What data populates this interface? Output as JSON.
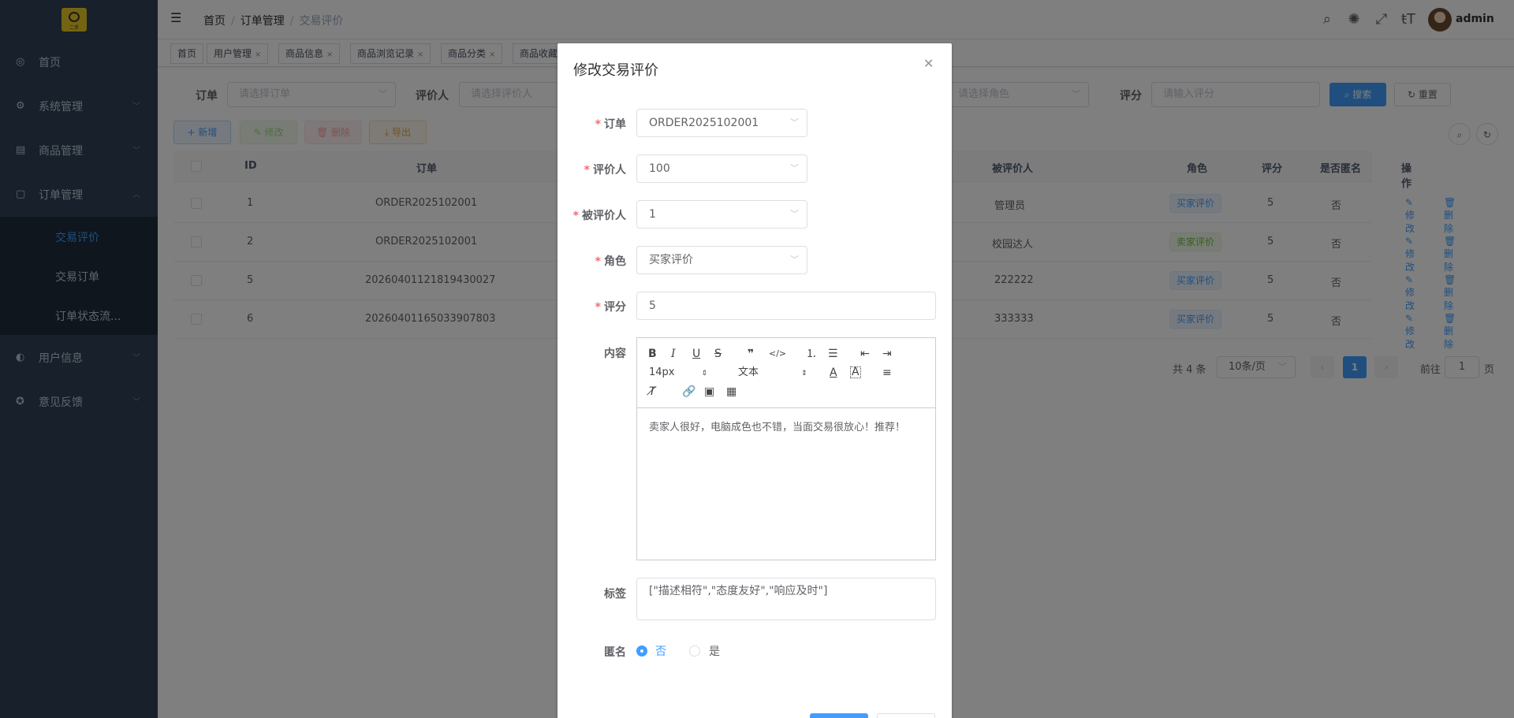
{
  "sidebar": {
    "logo_text": "二手",
    "items": [
      {
        "label": "首页",
        "icon": "dashboard-icon"
      },
      {
        "label": "系统管理",
        "icon": "gear-icon"
      },
      {
        "label": "商品管理",
        "icon": "goods-icon"
      },
      {
        "label": "订单管理",
        "icon": "book-icon"
      },
      {
        "label": "用户信息",
        "icon": "user-icon"
      },
      {
        "label": "意见反馈",
        "icon": "feedback-icon"
      }
    ],
    "sub_items": [
      {
        "label": "交易评价",
        "active": true
      },
      {
        "label": "交易订单"
      },
      {
        "label": "订单状态流..."
      }
    ]
  },
  "navbar": {
    "breadcrumb": [
      "首页",
      "订单管理",
      "交易评价"
    ],
    "username": "admin"
  },
  "tags": [
    {
      "label": "首页",
      "closable": false
    },
    {
      "label": "用户管理",
      "closable": true
    },
    {
      "label": "商品信息",
      "closable": true
    },
    {
      "label": "商品浏览记录",
      "closable": true
    },
    {
      "label": "商品分类",
      "closable": true
    },
    {
      "label": "商品收藏",
      "closable": true
    }
  ],
  "search": {
    "order_label": "订单",
    "order_placeholder": "请选择订单",
    "reviewer_label": "评价人",
    "reviewer_placeholder": "请选择评价人",
    "role_placeholder": "请选择角色",
    "score_label": "评分",
    "score_placeholder": "请输入评分",
    "search_btn": "搜索",
    "reset_btn": "重置"
  },
  "actions": {
    "add": "新增",
    "edit": "修改",
    "delete": "删除",
    "export": "导出"
  },
  "table": {
    "headers": {
      "id": "ID",
      "order": "订单",
      "reviewee": "被评价人",
      "role": "角色",
      "score": "评分",
      "anonymous": "是否匿名",
      "op": "操作"
    },
    "rows": [
      {
        "id": "1",
        "order": "ORDER2025102001",
        "reviewee": "管理员",
        "role": "买家评价",
        "role_color": "blue",
        "score": "5",
        "anonymous": "否"
      },
      {
        "id": "2",
        "order": "ORDER2025102001",
        "reviewee": "校园达人",
        "role": "卖家评价",
        "role_color": "green",
        "score": "5",
        "anonymous": "否"
      },
      {
        "id": "5",
        "order": "20260401121819430027",
        "reviewee": "222222",
        "role": "买家评价",
        "role_color": "blue",
        "score": "5",
        "anonymous": "否"
      },
      {
        "id": "6",
        "order": "20260401165033907803",
        "reviewee": "333333",
        "role": "买家评价",
        "role_color": "blue",
        "score": "5",
        "anonymous": "否"
      }
    ],
    "op_edit": "修改",
    "op_delete": "删除"
  },
  "pagination": {
    "total": "共 4 条",
    "page_size": "10条/页",
    "current": "1",
    "goto_label": "前往",
    "goto_value": "1",
    "page_suffix": "页"
  },
  "dialog": {
    "title": "修改交易评价",
    "order_label": "订单",
    "order_value": "ORDER2025102001",
    "reviewer_label": "评价人",
    "reviewer_value": "100",
    "reviewee_label": "被评价人",
    "reviewee_value": "1",
    "role_label": "角色",
    "role_value": "买家评价",
    "score_label": "评分",
    "score_value": "5",
    "content_label": "内容",
    "font_size": "14px",
    "font_type": "文本",
    "content_value": "卖家人很好，电脑成色也不错，当面交易很放心！推荐！",
    "tags_label": "标签",
    "tags_value": "[\"描述相符\",\"态度友好\",\"响应及时\"]",
    "anon_label": "匿名",
    "anon_no": "否",
    "anon_yes": "是"
  },
  "colors": {
    "sidebar_bg": "#304156",
    "primary": "#409eff",
    "success": "#67c23a",
    "danger": "#f56c6c",
    "warning": "#e6a23c"
  }
}
